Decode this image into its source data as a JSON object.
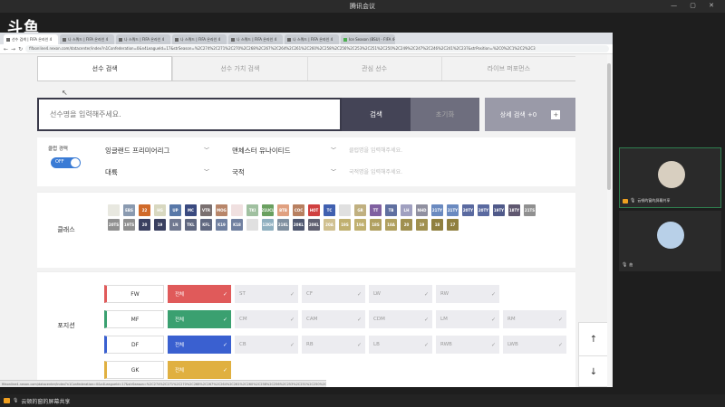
{
  "meeting": {
    "title": "腾讯会议",
    "share_label": "云顿的窗的屏幕共享",
    "window_controls": "— ▢ ✕"
  },
  "logo_text": "斗鱼",
  "browser": {
    "tabs": [
      {
        "label": "선수 검색 | FIFA 온라인 4"
      },
      {
        "label": "나 스쿼드 | FIFA 온라인 4"
      },
      {
        "label": "나 스쿼드 | FIFA 온라인 4"
      },
      {
        "label": "나 스쿼드 | FIFA 온라인 4"
      },
      {
        "label": "나 스쿼드 | FIFA 온라인 4"
      },
      {
        "label": "나 스쿼드 | FIFA 온라인 4"
      },
      {
        "label": "Ice Season (BSU) - FIFA 4주"
      }
    ],
    "url": "fifaonline4.nexon.com/datacenter/index?n1Confederation=0&n4LeagueId=17&strSeason=%2C274%2C271%2C270%2C268%2C267%2C264%2C261%2C260%2C258%2C256%2C253%2C251%2C250%2C249%2C247%2C246%2C241%2C237&strPosition=%2C0%2C1%2C2%2C3"
  },
  "search": {
    "tabs": [
      "선수 검색",
      "선수 가치 검색",
      "관심 선수",
      "라이브 퍼포먼스"
    ],
    "placeholder": "선수명을 입력해주세요.",
    "search_button": "검색",
    "reset_button": "초기화",
    "advanced_button": "상세 검색 +0",
    "plus_icon": "+"
  },
  "club": {
    "label": "클럽 경력",
    "toggle": "OFF",
    "league": "잉글랜드 프리미어리그",
    "team": "맨체스터 유나이티드",
    "club_placeholder": "클럽명을 입력해주세요.",
    "continent": "대륙",
    "nationality": "국적",
    "nationality_placeholder": "국적명을 입력해주세요."
  },
  "class_section": {
    "label": "클래스",
    "cards": [
      {
        "t": "",
        "c": "#e8e8e0"
      },
      {
        "t": "EBS",
        "c": "#8a9ab0"
      },
      {
        "t": "22",
        "c": "#d06a2a"
      },
      {
        "t": "HG",
        "c": "#d8d8c0"
      },
      {
        "t": "UP",
        "c": "#5878a8"
      },
      {
        "t": "MC",
        "c": "#3a4a80"
      },
      {
        "t": "VTR",
        "c": "#7a7070"
      },
      {
        "t": "MOG",
        "c": "#b8866a"
      },
      {
        "t": "",
        "c": "#f0e0e0"
      },
      {
        "t": "TKI",
        "c": "#a0c0a0"
      },
      {
        "t": "21UCL",
        "c": "#6aa060"
      },
      {
        "t": "BTB",
        "c": "#e0a080"
      },
      {
        "t": "COC",
        "c": "#b88060"
      },
      {
        "t": "HOT",
        "c": "#d04040"
      },
      {
        "t": "TC",
        "c": "#4060b0"
      },
      {
        "t": "",
        "c": "#e0e0e0"
      },
      {
        "t": "GR",
        "c": "#c0b080"
      },
      {
        "t": "TT",
        "c": "#8060a0"
      },
      {
        "t": "TB",
        "c": "#6070a0"
      },
      {
        "t": "LH",
        "c": "#a0a0c0"
      },
      {
        "t": "NHD",
        "c": "#9090a0"
      },
      {
        "t": "21TY",
        "c": "#6a8ac0"
      },
      {
        "t": "21TY",
        "c": "#6a8ac0"
      },
      {
        "t": "20TY",
        "c": "#5a6aa0"
      },
      {
        "t": "20TY",
        "c": "#5a6aa0"
      },
      {
        "t": "19TY",
        "c": "#505a8a"
      },
      {
        "t": "18TY",
        "c": "#605870"
      },
      {
        "t": "21TS",
        "c": "#909090"
      },
      {
        "t": "20TS",
        "c": "#909090"
      },
      {
        "t": "19TS",
        "c": "#909090"
      },
      {
        "t": "20",
        "c": "#3a4060"
      },
      {
        "t": "19",
        "c": "#3a4060"
      },
      {
        "t": "LN",
        "c": "#707890"
      },
      {
        "t": "TKL",
        "c": "#606880"
      },
      {
        "t": "KFL",
        "c": "#606880"
      },
      {
        "t": "K19",
        "c": "#7080a0"
      },
      {
        "t": "K18",
        "c": "#7080a0"
      },
      {
        "t": "",
        "c": "#e0e0e0"
      },
      {
        "t": "12KH",
        "c": "#90b0c0"
      },
      {
        "t": "21KL",
        "c": "#8090a0"
      },
      {
        "t": "20KL",
        "c": "#505870"
      },
      {
        "t": "20KL",
        "c": "#606070"
      },
      {
        "t": "20A",
        "c": "#d0c090"
      },
      {
        "t": "19S",
        "c": "#c0b070"
      },
      {
        "t": "19A",
        "c": "#c0b070"
      },
      {
        "t": "18S",
        "c": "#b0a060"
      },
      {
        "t": "18A",
        "c": "#b0a060"
      },
      {
        "t": "20",
        "c": "#a09050"
      },
      {
        "t": "19",
        "c": "#a09050"
      },
      {
        "t": "18",
        "c": "#908040"
      },
      {
        "t": "17",
        "c": "#908040"
      }
    ]
  },
  "position_section": {
    "label": "포지션",
    "check_icon": "✓",
    "all_label": "전체",
    "rows": [
      {
        "pos": "FW",
        "accent": "#e05a5a",
        "opts": [
          "ST",
          "CF",
          "LW",
          "RW"
        ]
      },
      {
        "pos": "MF",
        "accent": "#3aa070",
        "opts": [
          "CM",
          "CAM",
          "CDM",
          "LM",
          "RM"
        ]
      },
      {
        "pos": "DF",
        "accent": "#3a60d0",
        "opts": [
          "CB",
          "RB",
          "LB",
          "RWB",
          "LWB"
        ]
      },
      {
        "pos": "GK",
        "accent": "#e0b040",
        "opts": []
      }
    ]
  },
  "scroll": {
    "up": "↑",
    "down": "↓"
  },
  "participants": [
    {
      "name": "云顿的窗的屏幕共享"
    },
    {
      "name": "曲"
    }
  ]
}
